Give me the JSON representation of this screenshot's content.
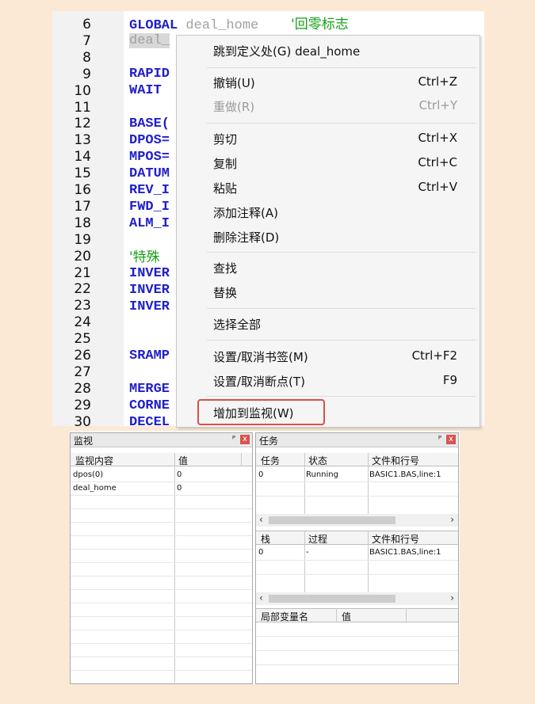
{
  "editor": {
    "line_numbers": [
      "6",
      "7",
      "8",
      "9",
      "10",
      "11",
      "12",
      "13",
      "14",
      "15",
      "16",
      "17",
      "18",
      "19",
      "20",
      "21",
      "22",
      "23",
      "24",
      "25",
      "26",
      "27",
      "28",
      "29",
      "30"
    ],
    "lines": {
      "l6_kw": "GLOBAL",
      "l6_ident": "deal_home",
      "l6_comment": "'回零标志",
      "l7_ident": "deal_",
      "l9": "RAPID",
      "l10": "WAIT",
      "l12": "BASE(",
      "l13": "DPOS=",
      "l14": "MPOS=",
      "l15": "DATUM",
      "l16": "REV_I",
      "l17": "FWD_I",
      "l18": "ALM_I",
      "l20": "'特殊",
      "l21": "INVER",
      "l22": "INVER",
      "l23": "INVER",
      "l26": "SRAMP",
      "l28": "MERGE",
      "l29": "CORNE",
      "l30": "DECEL"
    }
  },
  "context_menu": {
    "goto_def": "跳到定义处(G) deal_home",
    "undo": "撤销(U)",
    "undo_sc": "Ctrl+Z",
    "redo": "重做(R)",
    "redo_sc": "Ctrl+Y",
    "cut": "剪切",
    "cut_sc": "Ctrl+X",
    "copy": "复制",
    "copy_sc": "Ctrl+C",
    "paste": "粘贴",
    "paste_sc": "Ctrl+V",
    "add_comment": "添加注释(A)",
    "del_comment": "删除注释(D)",
    "find": "查找",
    "replace": "替换",
    "select_all": "选择全部",
    "bookmark": "设置/取消书签(M)",
    "bookmark_sc": "Ctrl+F2",
    "breakpoint": "设置/取消断点(T)",
    "breakpoint_sc": "F9",
    "add_watch": "增加到监视(W)"
  },
  "watch_panel": {
    "title": "监视",
    "pin": "ᴾ",
    "close": "x",
    "col_content": "监视内容",
    "col_value": "值",
    "rows": [
      {
        "name": "dpos(0)",
        "value": "0"
      },
      {
        "name": "deal_home",
        "value": "0"
      }
    ]
  },
  "task_panel": {
    "title": "任务",
    "pin": "ᴾ",
    "close": "x",
    "tasks_header": {
      "task": "任务",
      "state": "状态",
      "file": "文件和行号"
    },
    "tasks_row": {
      "task": "0",
      "state": "Running",
      "file": "BASIC1.BAS,line:1"
    },
    "stack_header": {
      "stack": "栈",
      "proc": "过程",
      "file": "文件和行号"
    },
    "stack_row": {
      "stack": "0",
      "proc": "-",
      "file": "BASIC1.BAS,line:1"
    },
    "locals_header": {
      "name": "局部变量名",
      "value": "值"
    },
    "scroll_left": "‹",
    "scroll_right": "›"
  },
  "colors": {
    "keyword": "#2020c8",
    "comment": "#18a018",
    "highlight_box": "#d8504a",
    "close_button": "#d9534f"
  }
}
